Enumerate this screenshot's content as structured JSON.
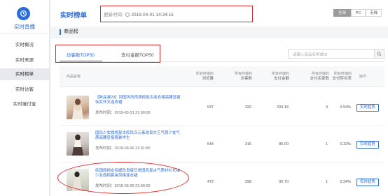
{
  "sidebar": {
    "title": "实时直播",
    "items": [
      {
        "label": "实时概况"
      },
      {
        "label": "实时来源"
      },
      {
        "label": "实时榜单"
      },
      {
        "label": "实时访客"
      },
      {
        "label": "实时催付宝"
      }
    ],
    "active_index": 2
  },
  "header": {
    "title": "实时榜单",
    "update_label": "更新时间:",
    "update_time": "2019-04-01 14:34:15",
    "devices": [
      "全部",
      "PC",
      "无线"
    ],
    "active_device": "全部"
  },
  "section": {
    "title": "商品榜"
  },
  "tabs": [
    {
      "label": "访客数TOP50"
    },
    {
      "label": "支付金额TOP50"
    }
  ],
  "search": {
    "placeholder": "请输入商品名称或ID"
  },
  "table": {
    "headers": {
      "product": "商品名称",
      "views": {
        "l1": "所有终端的",
        "l2": "浏览量"
      },
      "visitors": {
        "l1": "所有终端的",
        "l2": "访客数"
      },
      "pay_amount": {
        "l1": "所有终端的",
        "l2": "支付金额"
      },
      "buyers": {
        "l1": "所有终端的",
        "l2": "支付买家数"
      },
      "conversion": {
        "l1": "所有终端的",
        "l2": "支付转化率"
      },
      "action": "操作"
    },
    "rows": [
      {
        "title": "【新品减20】回国风改良旗袍复古连衣裙高腰显瘦仙女开叉连衣裙",
        "time": "发布时间：2019-03-31 21:00:00",
        "views": "537",
        "visitors": "320",
        "pay_amount": "204.18",
        "buyers": "3",
        "conversion": "0.94%",
        "action": "实时趋势"
      },
      {
        "title": "国风少女旗袍复古民风汉元素改良文艺气质少女气质高腰显瘦套装学生",
        "time": "发布时间：2019-03-06 21:31:50",
        "views": "544",
        "visitors": "316",
        "pay_amount": "85.00",
        "buyers": "1",
        "conversion": "0.32%",
        "action": "实时趋势"
      },
      {
        "title": "民国旗袍女名媛改良版日常国风复古气质衬衫长袖少女旗袍套装风格连衣裙",
        "time": "发布时间：2019-03-26 21:00:00",
        "views": "472",
        "visitors": "298",
        "pay_amount": "92.70",
        "buyers": "1",
        "conversion": "0.34%",
        "action": "实时趋势"
      }
    ]
  },
  "colors": {
    "accent": "#2d6bd6",
    "highlight": "#e02a2a"
  }
}
